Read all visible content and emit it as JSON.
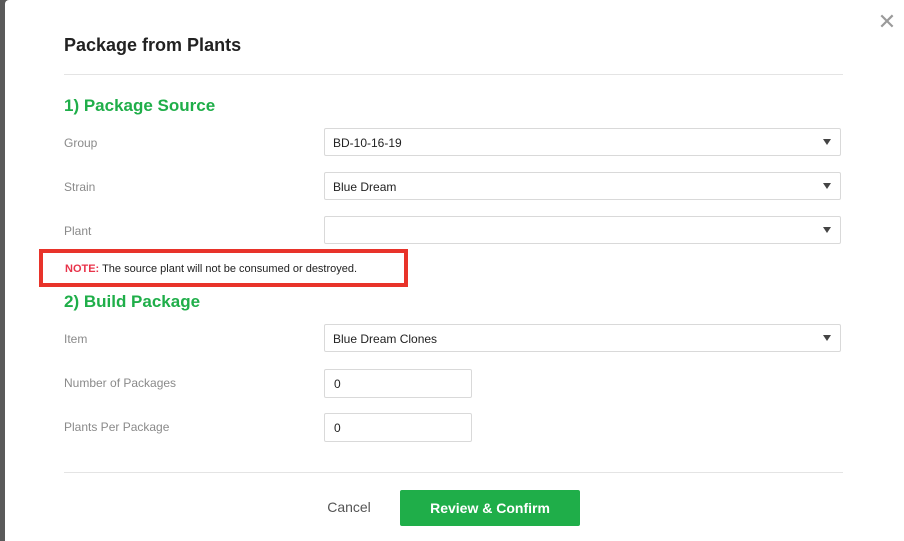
{
  "dialog": {
    "title": "Package from Plants",
    "close_icon": "close-icon"
  },
  "package_source": {
    "heading": "1) Package Source",
    "group": {
      "label": "Group",
      "value": "BD-10-16-19"
    },
    "strain": {
      "label": "Strain",
      "value": "Blue Dream"
    },
    "plant": {
      "label": "Plant",
      "value": ""
    },
    "note": {
      "prefix": "NOTE:",
      "text": " The source plant will not be consumed or destroyed."
    }
  },
  "build_package": {
    "heading": "2) Build Package",
    "item": {
      "label": "Item",
      "value": "Blue Dream Clones"
    },
    "number_of_packages": {
      "label": "Number of Packages",
      "value": "0"
    },
    "plants_per_package": {
      "label": "Plants Per Package",
      "value": "0"
    }
  },
  "footer": {
    "cancel_label": "Cancel",
    "confirm_label": "Review & Confirm"
  },
  "colors": {
    "accent": "#1fae49",
    "note_prefix": "#e8334a",
    "highlight_border": "#e8332a"
  }
}
